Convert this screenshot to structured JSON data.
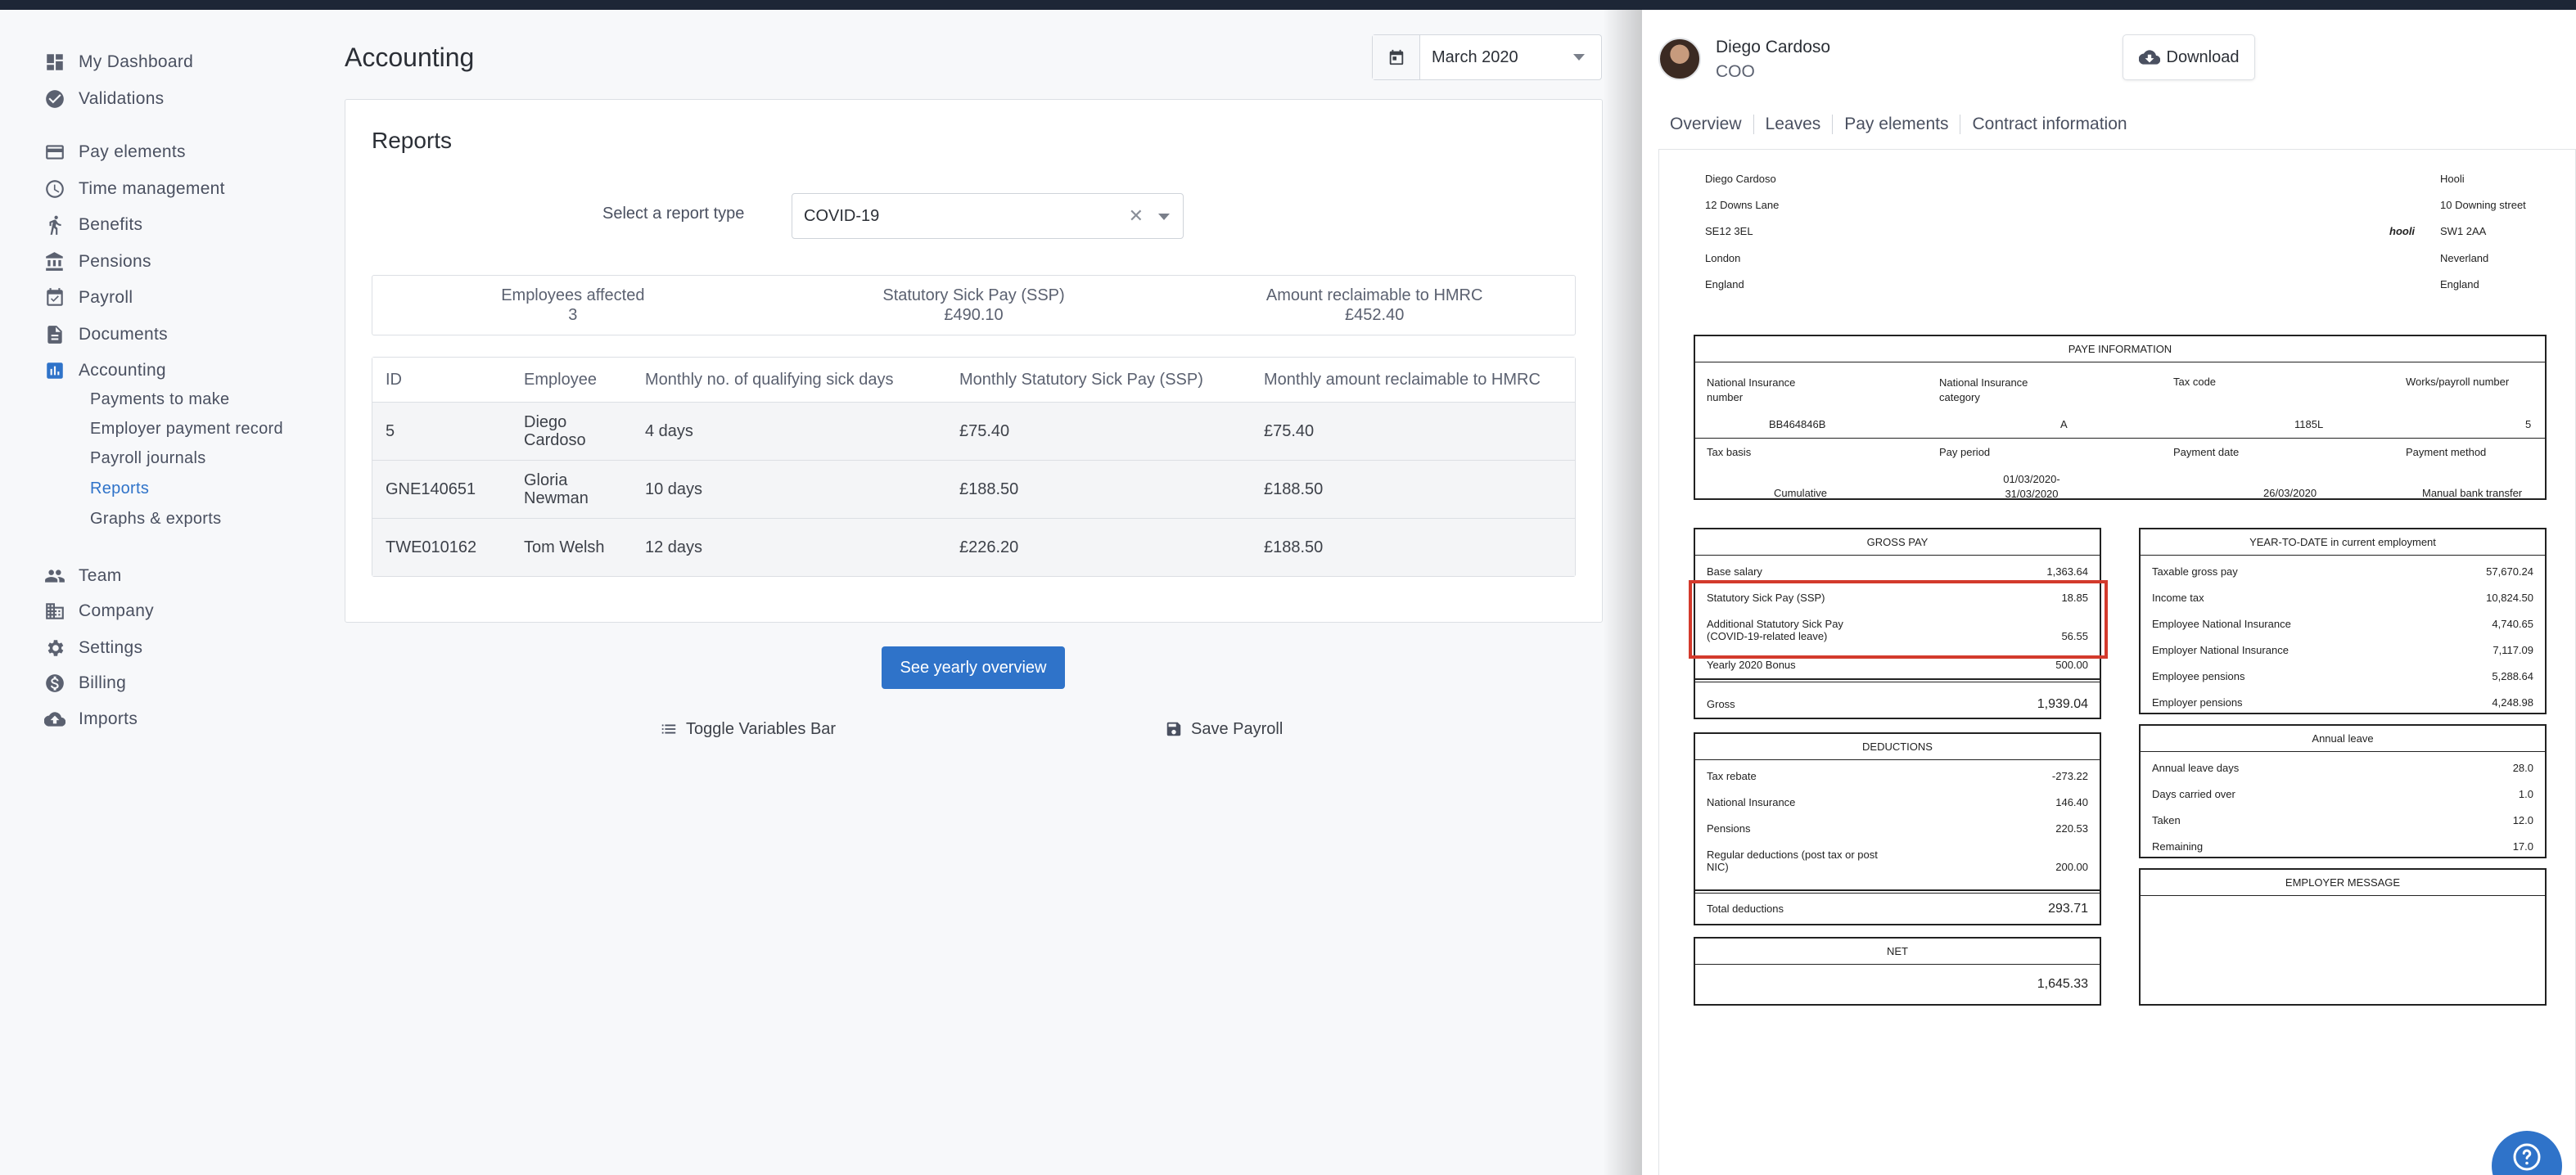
{
  "sidebar": {
    "items": [
      {
        "label": "My Dashboard",
        "icon": "dashboard-icon"
      },
      {
        "label": "Validations",
        "icon": "check-circle-icon"
      },
      {
        "label": "Pay elements",
        "icon": "credit-card-icon"
      },
      {
        "label": "Time management",
        "icon": "clock-icon"
      },
      {
        "label": "Benefits",
        "icon": "person-running-icon"
      },
      {
        "label": "Pensions",
        "icon": "bank-icon"
      },
      {
        "label": "Payroll",
        "icon": "calendar-check-icon"
      },
      {
        "label": "Documents",
        "icon": "document-icon"
      },
      {
        "label": "Accounting",
        "icon": "bar-chart-icon"
      },
      {
        "label": "Team",
        "icon": "people-icon"
      },
      {
        "label": "Company",
        "icon": "building-icon"
      },
      {
        "label": "Settings",
        "icon": "gear-icon"
      },
      {
        "label": "Billing",
        "icon": "dollar-icon"
      },
      {
        "label": "Imports",
        "icon": "cloud-upload-icon"
      }
    ],
    "accounting_sub": [
      "Payments to make",
      "Employer payment record",
      "Payroll journals",
      "Reports",
      "Graphs & exports"
    ],
    "active_item": "Accounting",
    "active_sub": "Reports",
    "accent_color": "#2f73c9"
  },
  "main": {
    "title": "Accounting",
    "date_value": "March 2020",
    "card_title": "Reports",
    "report_label": "Select a report type",
    "report_value": "COVID-19",
    "summary": [
      {
        "label": "Employees affected",
        "value": "3"
      },
      {
        "label": "Statutory Sick Pay (SSP)",
        "value": "£490.10"
      },
      {
        "label": "Amount reclaimable to HMRC",
        "value": "£452.40"
      }
    ],
    "table": {
      "headers": [
        "ID",
        "Employee",
        "Monthly no. of qualifying sick days",
        "Monthly Statutory Sick Pay (SSP)",
        "Monthly amount reclaimable to HMRC"
      ],
      "rows": [
        [
          "5",
          "Diego Cardoso",
          "4 days",
          "£75.40",
          "£75.40"
        ],
        [
          "GNE140651",
          "Gloria Newman",
          "10 days",
          "£188.50",
          "£188.50"
        ],
        [
          "TWE010162",
          "Tom Welsh",
          "12 days",
          "£226.20",
          "£188.50"
        ]
      ]
    },
    "yearly_button": "See yearly overview",
    "toggle_variables": "Toggle Variables Bar",
    "save_payroll": "Save Payroll"
  },
  "panel": {
    "name": "Diego Cardoso",
    "role": "COO",
    "download": "Download",
    "tabs": [
      "Overview",
      "Leaves",
      "Pay elements",
      "Contract information"
    ],
    "payslip": {
      "employee_address": [
        "Diego Cardoso",
        "12 Downs Lane",
        "SE12 3EL",
        "London",
        "England"
      ],
      "employer_address": [
        "Hooli",
        "10 Downing street",
        "SW1 2AA",
        "Neverland",
        "England"
      ],
      "logo_text": "hooli",
      "paye_title": "PAYE INFORMATION",
      "paye_labels": [
        "National Insurance number",
        "National Insurance category",
        "Tax code",
        "Works/payroll number"
      ],
      "paye_values": [
        "BB464846B",
        "A",
        "1185L",
        "5"
      ],
      "paye_labels2": [
        "Tax basis",
        "Pay period",
        "Payment date",
        "Payment method"
      ],
      "paye_values2": [
        "Cumulative",
        "01/03/2020-31/03/2020",
        "26/03/2020",
        "Manual bank transfer"
      ],
      "gross_title": "GROSS PAY",
      "gross_rows": [
        {
          "label": "Base salary",
          "amount": "1,363.64"
        },
        {
          "label": "Statutory Sick Pay (SSP)",
          "amount": "18.85"
        },
        {
          "label": "Additional Statutory Sick Pay (COVID-19-related leave)",
          "amount": "56.55"
        },
        {
          "label": "Yearly 2020 Bonus",
          "amount": "500.00"
        }
      ],
      "gross_total_label": "Gross",
      "gross_total": "1,939.04",
      "deductions_title": "DEDUCTIONS",
      "deduction_rows": [
        {
          "label": "Tax rebate",
          "amount": "-273.22"
        },
        {
          "label": "National Insurance",
          "amount": "146.40"
        },
        {
          "label": "Pensions",
          "amount": "220.53"
        },
        {
          "label": "Regular deductions (post tax or post NIC)",
          "amount": "200.00"
        }
      ],
      "deductions_total_label": "Total deductions",
      "deductions_total": "293.71",
      "net_title": "NET",
      "net_value": "1,645.33",
      "ytd_title": "YEAR-TO-DATE in current employment",
      "ytd_rows": [
        {
          "label": "Taxable gross pay",
          "amount": "57,670.24"
        },
        {
          "label": "Income tax",
          "amount": "10,824.50"
        },
        {
          "label": "Employee National Insurance",
          "amount": "4,740.65"
        },
        {
          "label": "Employer National Insurance",
          "amount": "7,117.09"
        },
        {
          "label": "Employee pensions",
          "amount": "5,288.64"
        },
        {
          "label": "Employer pensions",
          "amount": "4,248.98"
        }
      ],
      "leave_title": "Annual leave",
      "leave_rows": [
        {
          "label": "Annual leave days",
          "amount": "28.0"
        },
        {
          "label": "Days carried over",
          "amount": "1.0"
        },
        {
          "label": "Taken",
          "amount": "12.0"
        },
        {
          "label": "Remaining",
          "amount": "17.0"
        }
      ],
      "message_title": "EMPLOYER MESSAGE"
    }
  }
}
